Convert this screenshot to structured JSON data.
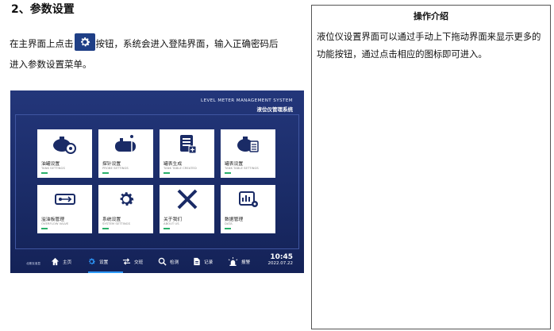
{
  "section_heading": "2、参数设置",
  "para": {
    "part1": "在主界面上点击",
    "part2": "按钮，系统会进入登陆界面，输入正确密码后",
    "line2": "进入参数设置菜单。"
  },
  "side": {
    "title": "操作介绍",
    "text": "液位仪设置界面可以通过手动上下拖动界面来显示更多的功能按钮，通过点击相应的图标即可进入。"
  },
  "device": {
    "title_en": "LEVEL METER MANAGEMENT SYSTEM",
    "title_zh": "液位仪管理系统",
    "tiles": [
      {
        "zh": "油罐设置",
        "en": "TANK SETTINGS",
        "icon": "tank-gear-icon"
      },
      {
        "zh": "探针设置",
        "en": "PROBE SETTINGS",
        "icon": "probe-tank-icon"
      },
      {
        "zh": "罐表生成",
        "en": "TANK TABLE CREATED",
        "icon": "table-add-icon"
      },
      {
        "zh": "罐表设置",
        "en": "TANK TABLE SETTINGS",
        "icon": "tank-table-icon"
      },
      {
        "zh": "溢油板管理",
        "en": "OVERFLOW VALVE",
        "icon": "valve-icon"
      },
      {
        "zh": "系统设置",
        "en": "SYSTEM SETTINGS",
        "icon": "gear-icon"
      },
      {
        "zh": "关于我们",
        "en": "ABOUT US",
        "icon": "about-logo-icon"
      },
      {
        "zh": "数据管理",
        "en": "DATA",
        "icon": "data-chart-icon"
      }
    ],
    "brand": "北斯克液显",
    "nav": [
      {
        "label": "主页",
        "icon": "home-icon"
      },
      {
        "label": "设置",
        "icon": "gear-icon"
      },
      {
        "label": "交班",
        "icon": "swap-icon"
      },
      {
        "label": "检测",
        "icon": "search-icon"
      },
      {
        "label": "记录",
        "icon": "document-icon"
      },
      {
        "label": "报警",
        "icon": "alarm-icon"
      }
    ],
    "time": "10:45",
    "date": "2022.07.22"
  }
}
